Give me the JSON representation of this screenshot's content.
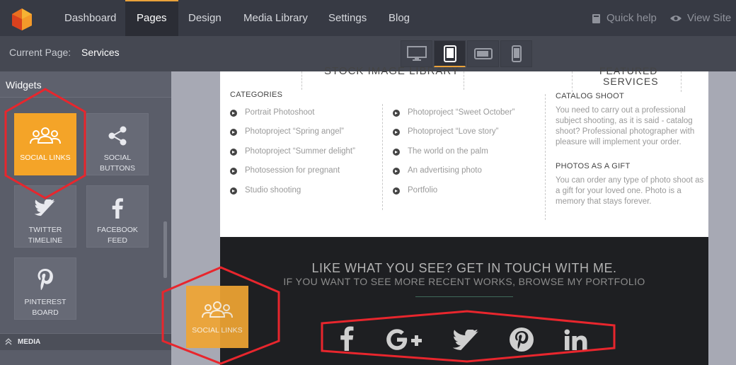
{
  "nav": {
    "items": [
      "Dashboard",
      "Pages",
      "Design",
      "Media Library",
      "Settings",
      "Blog"
    ],
    "active": "Pages",
    "quick_help": "Quick help",
    "view_site": "View Site"
  },
  "subbar": {
    "current_page_label": "Current Page:",
    "current_page_value": "Services",
    "devices": [
      "desktop-icon",
      "tablet-portrait-icon",
      "tablet-landscape-icon",
      "mobile-icon"
    ],
    "active_device": "tablet-portrait-icon"
  },
  "sidebar": {
    "title": "Widgets",
    "widgets": [
      {
        "label": "SOCIAL LINKS",
        "icon": "people-group-icon"
      },
      {
        "label": "SOCIAL BUTTONS",
        "line1": "SOCIAL",
        "line2": "BUTTONS",
        "icon": "share-icon"
      },
      {
        "label": "TWITTER TIMELINE",
        "line1": "TWITTER",
        "line2": "TIMELINE",
        "icon": "twitter-icon"
      },
      {
        "label": "FACEBOOK FEED",
        "icon": "facebook-icon"
      },
      {
        "label": "PINTEREST BOARD",
        "line1": "PINTEREST",
        "line2": "BOARD",
        "icon": "pinterest-icon"
      }
    ],
    "section": "MEDIA"
  },
  "page": {
    "heading_left": "STOCK IMAGE LIBRARY",
    "heading_right_1": "FEATURED",
    "heading_right_2": "SERVICES",
    "categories_title": "CATEGORIES",
    "col1": [
      "Portrait Photoshoot",
      "Photoproject “Spring angel”",
      "Photoproject “Summer delight”",
      "Photosession for pregnant",
      "Studio shooting"
    ],
    "col2": [
      "Photoproject “Sweet October”",
      "Photoproject “Love story”",
      "The world on the palm",
      "An advertising photo",
      "Portfolio"
    ],
    "catalog_title": "CATALOG SHOOT",
    "catalog_text": "You need to carry out a professional subject shooting, as it is said - catalog shoot? Professional photographer with pleasure will implement your order.",
    "gift_title": "PHOTOS AS A GIFT",
    "gift_text": "You can order any type of photo shoot as a gift for your loved one. Photo is a memory that stays forever."
  },
  "cta": {
    "main": "LIKE WHAT YOU SEE? GET IN TOUCH WITH ME.",
    "sub": "IF YOU WANT TO SEE MORE RECENT WORKS, BROWSE MY PORTFOLIO",
    "social_icons": [
      "facebook-icon",
      "google-plus-icon",
      "twitter-icon",
      "pinterest-icon",
      "linkedin-icon"
    ]
  },
  "drag": {
    "label": "SOCIAL LINKS",
    "icon": "people-group-icon"
  },
  "colors": {
    "accent": "#f4a428",
    "annotation": "#e8262d",
    "topbar": "#373a44"
  }
}
